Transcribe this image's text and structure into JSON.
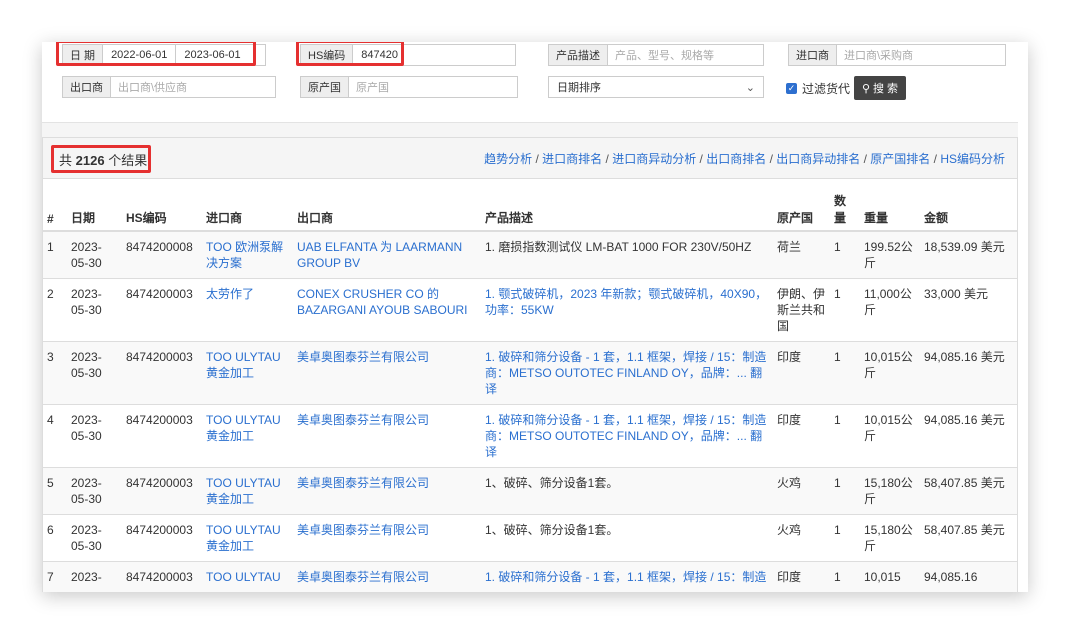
{
  "filters": {
    "date_label": "日 期",
    "date_from": "2022-06-01",
    "date_to": "2023-06-01",
    "hs_label": "HS编码",
    "hs_value": "847420",
    "desc_label": "产品描述",
    "desc_placeholder": "产品、型号、规格等",
    "importer_label": "进口商",
    "importer_placeholder": "进口商\\采购商",
    "exporter_label": "出口商",
    "exporter_placeholder": "出口商\\供应商",
    "origin_label": "原产国",
    "origin_placeholder": "原产国",
    "sort_value": "日期排序",
    "filter_cargo_label": "过滤货代",
    "search_label": "搜 索"
  },
  "results": {
    "prefix": "共",
    "count": "2126",
    "suffix": "个结果",
    "links": [
      "趋势分析",
      "进口商排名",
      "进口商异动分析",
      "出口商排名",
      "出口商异动排名",
      "原产国排名",
      "HS编码分析"
    ]
  },
  "table": {
    "headers": [
      "#",
      "日期",
      "HS编码",
      "进口商",
      "出口商",
      "产品描述",
      "原产国",
      "数量",
      "重量",
      "金额"
    ],
    "rows": [
      {
        "n": "1",
        "date": "2023-05-30",
        "hs": "8474200008",
        "importer": "TOO 欧洲泵解决方案",
        "exporter": "UAB ELFANTA 为 LAARMANN GROUP BV",
        "desc": "1. 磨损指数测试仪 LM-BAT 1000 FOR 230V/50HZ",
        "origin": "荷兰",
        "qty": "1",
        "weight": "199.52公斤",
        "amount": "18,539.09 美元"
      },
      {
        "n": "2",
        "date": "2023-05-30",
        "hs": "8474200003",
        "importer": "太劳作了",
        "exporter": "CONEX CRUSHER CO 的 BAZARGANI AYOUB SABOURI",
        "desc": "1. 颚式破碎机，2023 年新款；颚式破碎机，40X90，功率：55KW",
        "origin": "伊朗、伊斯兰共和国",
        "qty": "1",
        "weight": "11,000公斤",
        "amount": "33,000 美元"
      },
      {
        "n": "3",
        "date": "2023-05-30",
        "hs": "8474200003",
        "importer": "TOO ULYTAU 黄金加工",
        "exporter": "美卓奥图泰芬兰有限公司",
        "desc": "1. 破碎和筛分设备 - 1 套，1.1 框架，焊接 / 15：制造商：METSO OUTOTEC FINLAND OY，品牌：... 翻译",
        "origin": "印度",
        "qty": "1",
        "weight": "10,015公斤",
        "amount": "94,085.16 美元"
      },
      {
        "n": "4",
        "date": "2023-05-30",
        "hs": "8474200003",
        "importer": "TOO ULYTAU 黄金加工",
        "exporter": "美卓奥图泰芬兰有限公司",
        "desc": "1. 破碎和筛分设备 - 1 套，1.1 框架，焊接 / 15：制造商：METSO OUTOTEC FINLAND OY，品牌：... 翻译",
        "origin": "印度",
        "qty": "1",
        "weight": "10,015公斤",
        "amount": "94,085.16 美元"
      },
      {
        "n": "5",
        "date": "2023-05-30",
        "hs": "8474200003",
        "importer": "TOO ULYTAU 黄金加工",
        "exporter": "美卓奥图泰芬兰有限公司",
        "desc": "1、破碎、筛分设备1套。",
        "origin": "火鸡",
        "qty": "1",
        "weight": "15,180公斤",
        "amount": "58,407.85 美元"
      },
      {
        "n": "6",
        "date": "2023-05-30",
        "hs": "8474200003",
        "importer": "TOO ULYTAU 黄金加工",
        "exporter": "美卓奥图泰芬兰有限公司",
        "desc": "1、破碎、筛分设备1套。",
        "origin": "火鸡",
        "qty": "1",
        "weight": "15,180公斤",
        "amount": "58,407.85 美元"
      },
      {
        "n": "7",
        "date": "2023-",
        "hs": "8474200003",
        "importer": "TOO ULYTAU",
        "exporter": "美卓奥图泰芬兰有限公司",
        "desc": "1. 破碎和筛分设备 - 1 套，1.1 框架，焊接 / 15：制造",
        "origin": "印度",
        "qty": "1",
        "weight": "10,015",
        "amount": "94,085.16"
      }
    ]
  },
  "colors": {
    "link": "#2a6fcf",
    "highlight": "#e53030"
  }
}
